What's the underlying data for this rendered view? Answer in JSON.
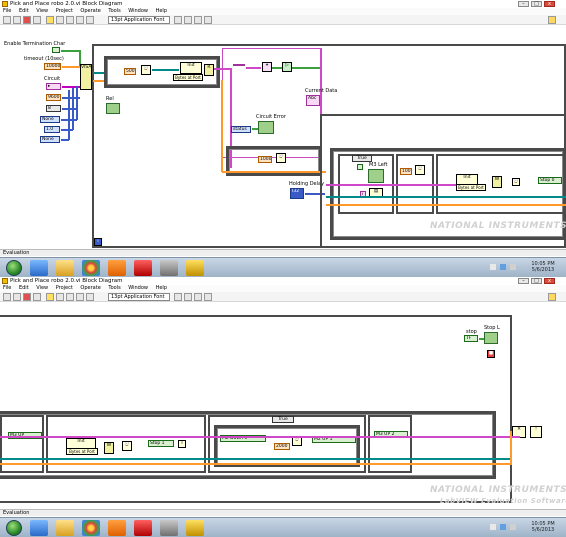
{
  "top_window": {
    "title": "Pick and Place robo 2.0.vi Block Diagram",
    "menu": [
      "File",
      "Edit",
      "View",
      "Project",
      "Operate",
      "Tools",
      "Window",
      "Help"
    ],
    "font_selector": "13pt Application Font",
    "status_label": "Evaluation",
    "diagram": {
      "enable_termination": "Enable Termination Char",
      "timeout": "timeout (10sec)",
      "timeout_value": "10000",
      "circuit": "Circuit",
      "baud": "9600",
      "none_1": "None",
      "stop_bits": "1.0",
      "none_2": "None",
      "init_label": "Init",
      "bytes_at_port": "Bytes at Port",
      "status": "status",
      "circuit_error": "Circuit Error",
      "current_data": "Current Data",
      "holding_delay": "Holding Delay",
      "case_true": "True",
      "m3_left": "M3 Left",
      "index_i": "i",
      "stop_label": "Stop 0",
      "num_500": "500",
      "num_1000": "1000",
      "num_100": "100"
    }
  },
  "bottom_window": {
    "title": "Pick and Place robo 2.0.vi Block Diagram",
    "menu": [
      "File",
      "Edit",
      "View",
      "Project",
      "Operate",
      "Tools",
      "Window",
      "Help"
    ],
    "font_selector": "13pt Application Font",
    "status_label": "Evaluation",
    "diagram": {
      "stop_ctrl": "stop",
      "stop_indicator": "Stop L",
      "m3_up": "M3 UP",
      "bytes_at_port": "Bytes at Port",
      "init_label": "Init",
      "stop_1": "Stop 1",
      "case_true": "True",
      "m2_down": "M2 Down 0",
      "m2_up": "M2 UP 1",
      "m3_up_2": "M3 UP 2",
      "num_500": "500",
      "num_2000": "2000",
      "num_100": "100"
    }
  },
  "watermark": {
    "line1": "NATIONAL",
    "line2": "INSTRUMENTS",
    "line3": "LabVIEW Evaluation Software"
  },
  "taskbar_top": {
    "clock_time": "10:05 PM",
    "clock_date": "5/6/2013"
  },
  "taskbar_bottom": {
    "clock_time": "10:05 PM",
    "clock_date": "5/6/2013"
  },
  "colors": {
    "wire_string": "#d048c8",
    "wire_bool": "#3ca03c",
    "wire_error": "#ff9a2a",
    "wire_refnum": "#008a8a",
    "frame": "#4a4a4a"
  }
}
